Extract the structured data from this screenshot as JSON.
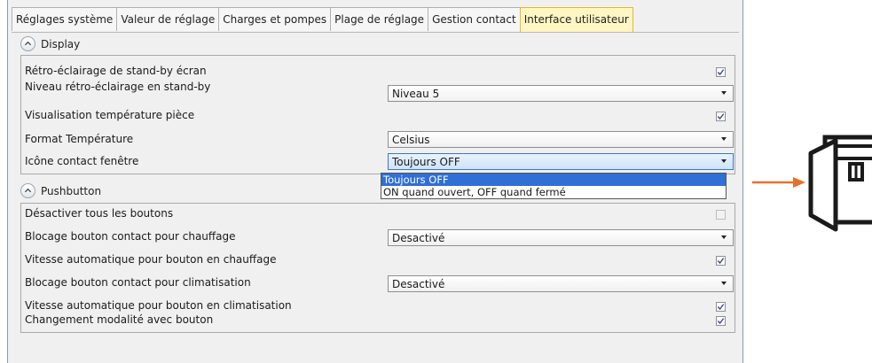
{
  "tabs": [
    {
      "label": "Réglages système"
    },
    {
      "label": "Valeur de réglage"
    },
    {
      "label": "Charges et pompes"
    },
    {
      "label": "Plage de réglage"
    },
    {
      "label": "Gestion contact"
    },
    {
      "label": "Interface utilisateur",
      "active": true
    }
  ],
  "display": {
    "title": "Display",
    "rows": [
      {
        "label": "Rétro-éclairage de stand-by écran",
        "checked": true
      },
      {
        "label": "Niveau rétro-éclairage en stand-by",
        "select": "Niveau 5"
      },
      {
        "label": "Visualisation température pièce",
        "checked": true
      },
      {
        "label": "Format Température",
        "select": "Celsius"
      },
      {
        "label": "Icône contact fenêtre",
        "select": "Toujours OFF"
      }
    ],
    "dropdown_options": [
      "Toujours OFF",
      "ON quand ouvert, OFF quand fermé"
    ]
  },
  "pushbutton": {
    "title": "Pushbutton",
    "rows": [
      {
        "label": "Désactiver tous les boutons",
        "checked": false
      },
      {
        "label": "Blocage bouton contact pour chauffage",
        "select": "Desactivé"
      },
      {
        "label": "Vitesse automatique pour bouton en chauffage",
        "checked": true
      },
      {
        "label": "Blocage bouton contact pour climatisation",
        "select": "Desactivé"
      },
      {
        "label": "Vitesse automatique pour bouton en climatisation",
        "checked": true
      },
      {
        "label": "Changement modalité avec bouton",
        "checked": true
      }
    ]
  },
  "colors": {
    "accent_arrow": "#e8702a",
    "active_tab": "#fff6c2",
    "selection": "#2f6fd6"
  },
  "icons": {
    "side_icon": "window-open-icon",
    "pointer": "arrow-right-icon"
  }
}
